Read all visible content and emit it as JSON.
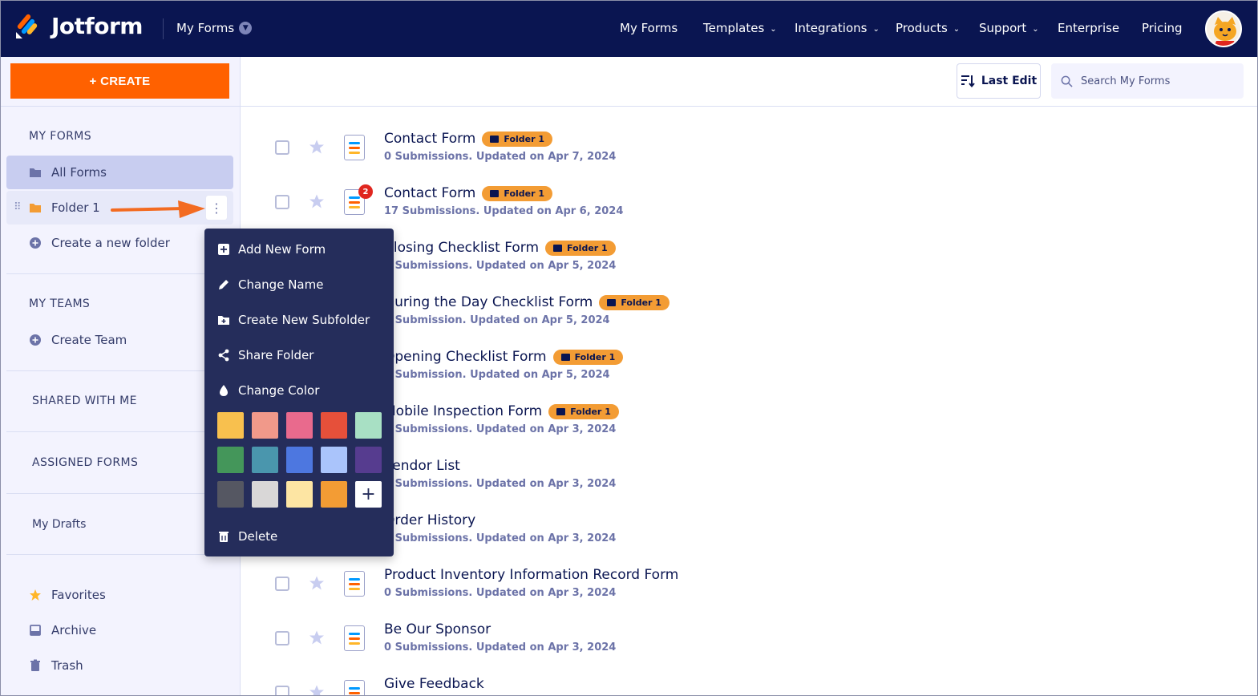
{
  "app": {
    "brand": "Jotform",
    "workspace_dropdown": "My Forms"
  },
  "nav": {
    "links": [
      "My Forms",
      "Templates",
      "Integrations",
      "Products",
      "Support",
      "Enterprise",
      "Pricing"
    ]
  },
  "sidebar": {
    "create_label": "+ CREATE",
    "my_forms_heading": "MY FORMS",
    "all_forms": "All Forms",
    "folder": "Folder 1",
    "create_folder": "Create a new folder",
    "my_teams_heading": "MY TEAMS",
    "create_team": "Create Team",
    "shared_heading": "SHARED WITH ME",
    "assigned_heading": "ASSIGNED FORMS",
    "drafts": "My Drafts",
    "favorites": "Favorites",
    "archive": "Archive",
    "trash": "Trash"
  },
  "toolbar": {
    "sort_label": "Last Edit",
    "search_placeholder": "Search My Forms"
  },
  "forms": [
    {
      "title": "Contact Form",
      "tag": "Folder 1",
      "subtitle": "0 Submissions. Updated on Apr 7, 2024",
      "badge": ""
    },
    {
      "title": "Contact Form",
      "tag": "Folder 1",
      "subtitle": "17 Submissions. Updated on Apr 6, 2024",
      "badge": "2"
    },
    {
      "title": "Closing Checklist Form",
      "tag": "Folder 1",
      "subtitle": "0 Submissions. Updated on Apr 5, 2024",
      "badge": ""
    },
    {
      "title": "During the Day Checklist Form",
      "tag": "Folder 1",
      "subtitle": "1 Submission. Updated on Apr 5, 2024",
      "badge": ""
    },
    {
      "title": "Opening Checklist Form",
      "tag": "Folder 1",
      "subtitle": "1 Submission. Updated on Apr 5, 2024",
      "badge": ""
    },
    {
      "title": "Mobile Inspection Form",
      "tag": "Folder 1",
      "subtitle": "0 Submissions. Updated on Apr 3, 2024",
      "badge": ""
    },
    {
      "title": "Vendor List",
      "tag": "",
      "subtitle": "0 Submissions. Updated on Apr 3, 2024",
      "badge": ""
    },
    {
      "title": "Order History",
      "tag": "",
      "subtitle": "0 Submissions. Updated on Apr 3, 2024",
      "badge": ""
    },
    {
      "title": "Product Inventory Information Record Form",
      "tag": "",
      "subtitle": "0 Submissions. Updated on Apr 3, 2024",
      "badge": ""
    },
    {
      "title": "Be Our Sponsor",
      "tag": "",
      "subtitle": "0 Submissions. Updated on Apr 3, 2024",
      "badge": ""
    },
    {
      "title": "Give Feedback",
      "tag": "",
      "subtitle": "",
      "badge": ""
    }
  ],
  "menu": {
    "items": [
      "Add New Form",
      "Change Name",
      "Create New Subfolder",
      "Share Folder",
      "Change Color"
    ],
    "delete": "Delete",
    "swatch_colors": [
      "#f8c04e",
      "#f1998a",
      "#e96a8d",
      "#e6503a",
      "#a8e0c4",
      "#44965a",
      "#4a96ad",
      "#4d77e0",
      "#aac4fb",
      "#563c8f",
      "#555762",
      "#d9d7d7",
      "#fde5a3",
      "#f39c34"
    ],
    "add_color": "+"
  },
  "colors": {
    "nav_bg": "#0a1551",
    "create_btn": "#ff6100",
    "sidebar_bg": "#f3f3fe",
    "menu_bg": "#252d5b",
    "tag": "#f39c34"
  }
}
